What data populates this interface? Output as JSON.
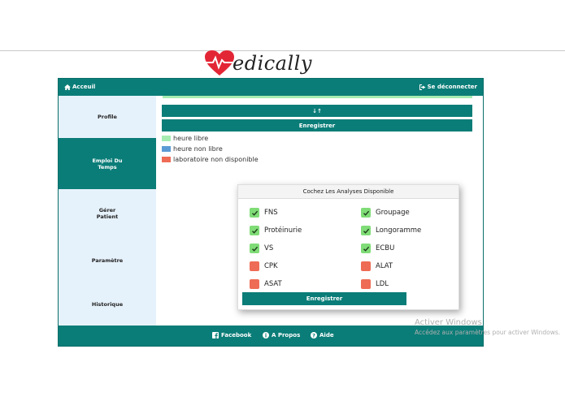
{
  "logo": {
    "text": "edically",
    "icon": "heart-pulse-icon",
    "color": "#e32636"
  },
  "header": {
    "home_label": "Acceuil",
    "home_icon": "home-icon",
    "logout_label": "Se déconnecter",
    "logout_icon": "sign-out-icon"
  },
  "sidebar": {
    "items": [
      {
        "label": "Profile",
        "active": false
      },
      {
        "label": "Emploi Du Temps",
        "active": true
      },
      {
        "label": "Gérer Patient",
        "active": false
      },
      {
        "label": "Paramètre",
        "active": false
      },
      {
        "label": "Historique",
        "active": false
      }
    ]
  },
  "main": {
    "sort_button_label": "↓↑",
    "save_button_label": "Enregistrer",
    "legend": [
      {
        "label": "heure libre",
        "color": "#a6ecb1"
      },
      {
        "label": "heure non libre",
        "color": "#5b9bd5"
      },
      {
        "label": "laboratoire non disponible",
        "color": "#ee6b55"
      }
    ]
  },
  "modal": {
    "title": "Cochez Les Analyses Disponible",
    "analyses": [
      {
        "label": "FNS",
        "checked": true
      },
      {
        "label": "Groupage",
        "checked": true
      },
      {
        "label": "Protéinurie",
        "checked": true
      },
      {
        "label": "Longoramme",
        "checked": true
      },
      {
        "label": "VS",
        "checked": true
      },
      {
        "label": "ECBU",
        "checked": true
      },
      {
        "label": "CPK",
        "checked": false
      },
      {
        "label": "ALAT",
        "checked": false
      },
      {
        "label": "ASAT",
        "checked": false
      },
      {
        "label": "LDL",
        "checked": false
      }
    ],
    "save_label": "Enregistrer"
  },
  "footer": {
    "facebook_label": "Facebook",
    "about_label": "A Propos",
    "help_label": "Aide"
  },
  "watermark": {
    "line1": "Activer Windows",
    "line2": "Accédez aux paramètres pour activer Windows."
  },
  "colors": {
    "primary": "#0b7d78",
    "sidebar_bg": "#e6f2fb",
    "checked": "#7fdc76",
    "unchecked": "#ee6b55"
  }
}
